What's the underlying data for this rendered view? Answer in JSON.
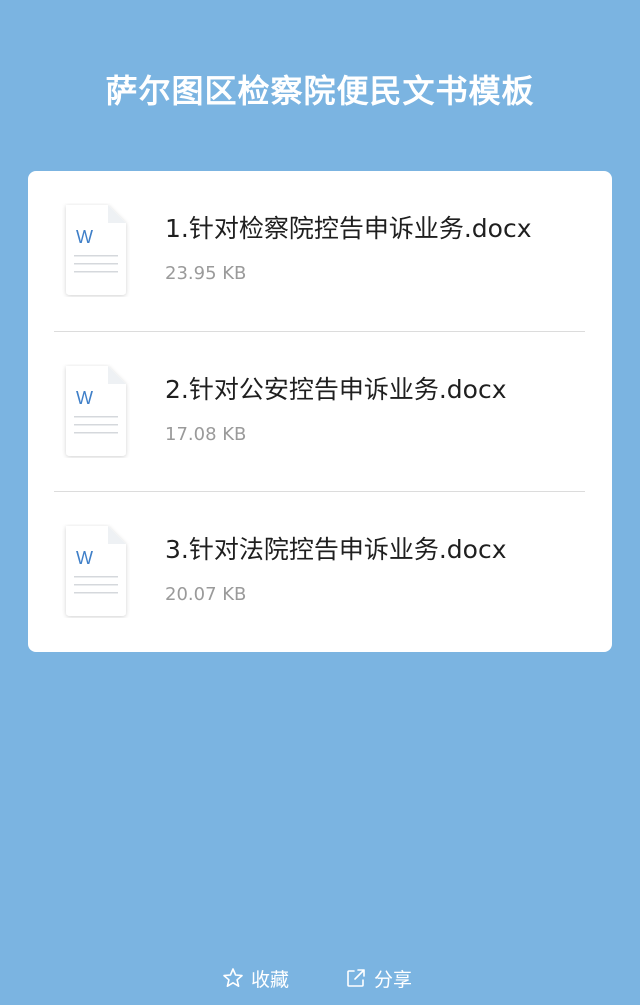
{
  "page": {
    "title": "萨尔图区检察院便民文书模板"
  },
  "files": [
    {
      "name": "1.针对检察院控告申诉业务.docx",
      "size": "23.95 KB",
      "icon": "word-doc-icon",
      "icon_letter": "W"
    },
    {
      "name": "2.针对公安控告申诉业务.docx",
      "size": "17.08 KB",
      "icon": "word-doc-icon",
      "icon_letter": "W"
    },
    {
      "name": "3.针对法院控告申诉业务.docx",
      "size": "20.07 KB",
      "icon": "word-doc-icon",
      "icon_letter": "W"
    }
  ],
  "actions": {
    "favorite_label": "收藏",
    "favorite_icon": "star-icon",
    "share_label": "分享",
    "share_icon": "share-icon"
  },
  "colors": {
    "background": "#7bb4e1",
    "card": "#ffffff",
    "word_blue": "#3f7fc8"
  }
}
